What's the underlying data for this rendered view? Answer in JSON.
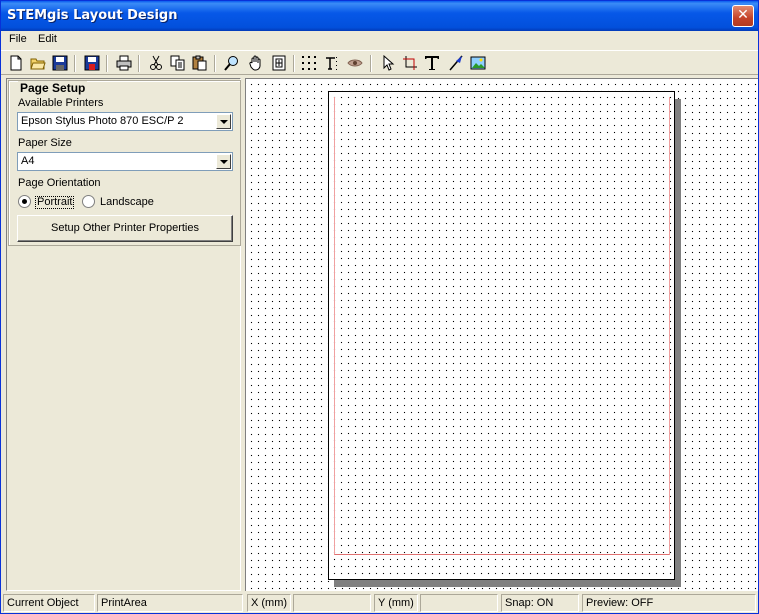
{
  "window": {
    "title": "STEMgis Layout Design",
    "close_glyph": "✕"
  },
  "menu": {
    "file": "File",
    "edit": "Edit"
  },
  "toolbar": {
    "icons": [
      "new-document-icon",
      "open-folder-icon",
      "save-disk-icon",
      "save-as-icon",
      "print-icon",
      "cut-icon",
      "copy-icon",
      "paste-icon",
      "zoom-icon",
      "pan-hand-icon",
      "fit-page-icon",
      "grid-dots-icon",
      "snap-text-icon",
      "eye-icon",
      "pointer-icon",
      "crop-select-icon",
      "text-tool-icon",
      "line-tool-icon",
      "image-tool-icon"
    ]
  },
  "page_setup": {
    "title": "Page Setup",
    "printers_label": "Available Printers",
    "printer_value": "Epson Stylus Photo 870 ESC/P 2",
    "paper_label": "Paper Size",
    "paper_value": "A4",
    "orientation_label": "Page Orientation",
    "portrait": "Portrait",
    "landscape": "Landscape",
    "orientation_selected": "Portrait",
    "setup_button": "Setup Other Printer Properties"
  },
  "status": {
    "current_object_label": "Current Object",
    "current_object_value": "PrintArea",
    "x_label": "X (mm)",
    "x_value": "",
    "y_label": "Y (mm)",
    "y_value": "",
    "snap": "Snap: ON",
    "preview": "Preview: OFF"
  }
}
